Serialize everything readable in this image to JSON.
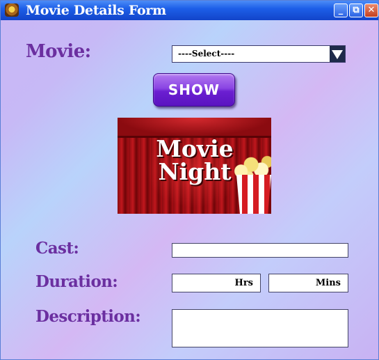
{
  "window": {
    "title": "Movie Details Form",
    "controls": {
      "minimize": "_",
      "restore": "⧉",
      "close": "✕"
    }
  },
  "form": {
    "movie_label": "Movie:",
    "movie_select_value": "----Select----",
    "show_button": "SHOW",
    "poster_text": "Movie Night",
    "cast_label": "Cast:",
    "cast_value": "",
    "duration_label": "Duration:",
    "hours_unit": "Hrs",
    "minutes_unit": "Mins",
    "description_label": "Description:",
    "description_value": ""
  },
  "colors": {
    "label": "#6b2fa0",
    "button": "#6b1fd1",
    "titlebar": "#1d5fe8"
  }
}
